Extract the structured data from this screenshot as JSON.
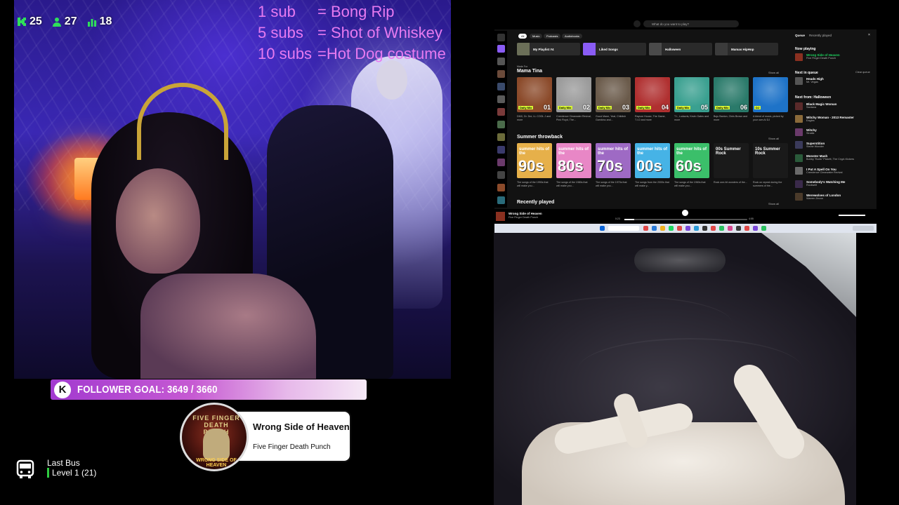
{
  "stream": {
    "stats": {
      "kick": "25",
      "followers": "27",
      "viewers": "18"
    },
    "sub_rules": [
      {
        "count": "1 sub",
        "reward": "= Bong Rip"
      },
      {
        "count": "5 subs",
        "reward": "= Shot of Whiskey"
      },
      {
        "count": "10 subs",
        "reward": "=Hot Dog costume"
      }
    ],
    "follower_goal": {
      "icon": "K",
      "text": "FOLLOWER GOAL: 3649 / 3660",
      "current": 3649,
      "target": 3660
    },
    "now_playing": {
      "title": "Wrong Side of Heaven",
      "artist": "Five Finger Death Punch",
      "art_band": "FIVE FINGER DEATH PUNCH",
      "art_title": "WRONG SIDE OF HEAVEN"
    },
    "bus": {
      "name": "Last Bus",
      "level": "Level 1  (21)"
    },
    "colors": {
      "sub_text": "#e77af0",
      "goal_start": "#a23ad0",
      "level_bar": "#2ecc40"
    }
  },
  "spotify": {
    "search_placeholder": "What do you want to play?",
    "chips": [
      "All",
      "Music",
      "Podcasts",
      "Audiobooks"
    ],
    "quick": [
      {
        "label": "My Playlist #4",
        "color": "#6b6f58"
      },
      {
        "label": "Liked Songs",
        "color": "#8a5cf5"
      },
      {
        "label": "Halloween",
        "color": "#4a4a4a"
      },
      {
        "label": "Mamas HipHop",
        "color": "#3b3b3b"
      }
    ],
    "made_for": "Made For",
    "section1": {
      "title": "Mama Tina",
      "show_all": "Show all",
      "cards": [
        {
          "tag": "Daily Mix",
          "num": "01",
          "caption": "DMX, Dr. Dre, LL COOL J and more",
          "color": "#8b4a2a"
        },
        {
          "tag": "Daily Mix",
          "num": "02",
          "caption": "Creedence Clearwater Revival, Pink Floyd, The...",
          "color": "#9a9a9a"
        },
        {
          "tag": "Daily Mix",
          "num": "03",
          "caption": "Gucci Mane, Yeat, Childish Gambino and...",
          "color": "#6a5a4a"
        },
        {
          "tag": "Daily Mix",
          "num": "04",
          "caption": "Rayvon House, The Game, T.I.O and more",
          "color": "#b03030"
        },
        {
          "tag": "Daily Mix",
          "num": "05",
          "caption": "T.I., Ludacris, Kevin Gates and more",
          "color": "#3aa090"
        },
        {
          "tag": "Daily Mix",
          "num": "06",
          "caption": "Buju Banton, Chris Brown and more",
          "color": "#2a7a6a"
        },
        {
          "tag": "DJ",
          "num": "",
          "caption": "A blend of music, picked by your own AI DJ",
          "color": "#1e73c8"
        }
      ]
    },
    "section2": {
      "title": "Summer throwback",
      "show_all": "Show all",
      "cards": [
        {
          "small": "summer hits of the",
          "big": "90s",
          "caption": "The songs of the 1990s that will make you...",
          "color": "#e6b04a"
        },
        {
          "small": "summer hits of the",
          "big": "80s",
          "caption": "The songs of the 1980s that will make you...",
          "color": "#e887c6"
        },
        {
          "small": "summer hits of the",
          "big": "70s",
          "caption": "The songs of the 1970s that will make you...",
          "color": "#9e6ac4"
        },
        {
          "small": "summer hits of the",
          "big": "00s",
          "caption": "The songs from the 2000s that will make y...",
          "color": "#46b3e6"
        },
        {
          "small": "summer hits of the",
          "big": "60s",
          "caption": "The songs of the 1960s that will make you...",
          "color": "#3bbf6a"
        },
        {
          "small": "00s Summer Rock",
          "big": "",
          "caption": "Rock one-hit wonders of the...",
          "color": "#1a1a1a"
        },
        {
          "small": "10s Summer Rock",
          "big": "",
          "caption": "Rock on repeat during the summers of the...",
          "color": "#1a1a1a"
        }
      ]
    },
    "section3": {
      "title": "Recently played",
      "show_all": "Show all"
    },
    "queue": {
      "tabs": [
        "Queue",
        "Recently played"
      ],
      "now_playing_label": "Now playing",
      "now": {
        "title": "Wrong Side of Heaven",
        "artist": "Five Finger Death Punch"
      },
      "next_label": "Next in queue",
      "clear": "Clear queue",
      "next": {
        "title": "Heads High",
        "artist": "Mr. Vegas"
      },
      "from_label": "Next from: Halloween",
      "items": [
        {
          "title": "Black Magic Woman",
          "artist": "Santana"
        },
        {
          "title": "Witchy Woman - 2013 Remaster",
          "artist": "Eagles"
        },
        {
          "title": "Witchy",
          "artist": "Sinalla"
        },
        {
          "title": "Superstition",
          "artist": "Stevie Wonder"
        },
        {
          "title": "Monster Mash",
          "artist": "Bobby \"Boris\" Pickett, The Crypt-Kickers"
        },
        {
          "title": "I Put A Spell On You",
          "artist": "Creedence Clearwater Revival"
        },
        {
          "title": "Somebody's Watching Me",
          "artist": "Rockwell"
        },
        {
          "title": "Werewolves of London",
          "artist": "Warren Zevon"
        }
      ]
    },
    "player": {
      "title": "Wrong Side of Heaven",
      "artist": "Five Finger Death Punch",
      "elapsed": "0:23",
      "total": "4:55",
      "progress": 0.08
    }
  }
}
